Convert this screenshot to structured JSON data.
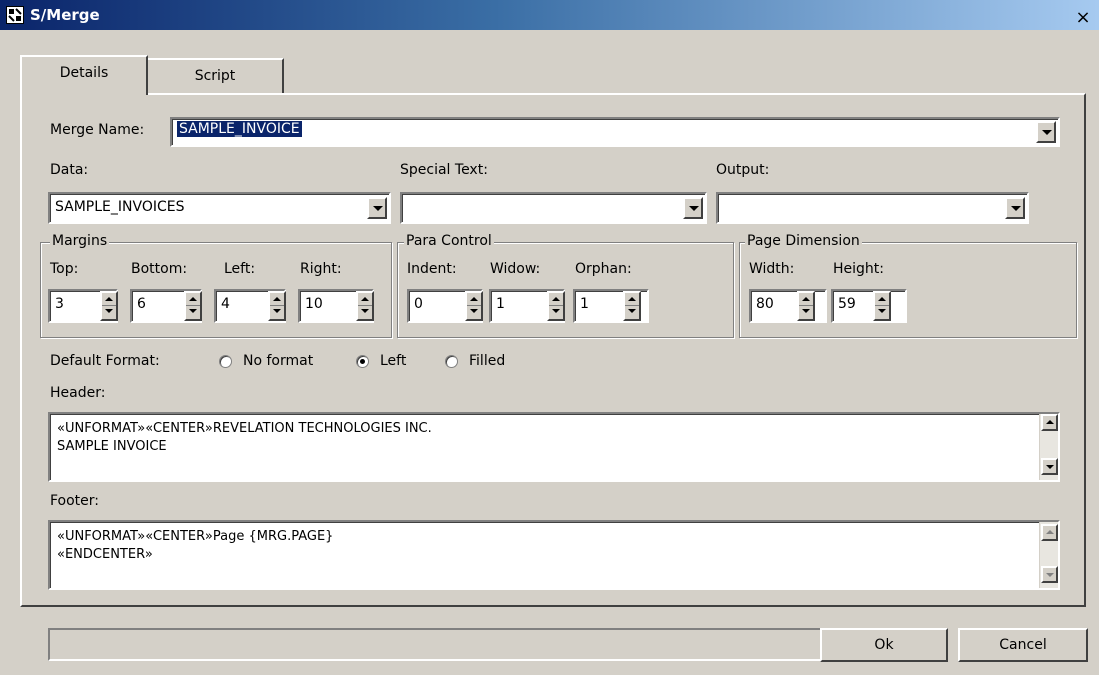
{
  "window": {
    "title": "S/Merge",
    "close_symbol": "×"
  },
  "tabs": [
    {
      "label": "Details",
      "active": true
    },
    {
      "label": "Script",
      "active": false
    }
  ],
  "merge_name": {
    "label": "Merge Name:",
    "value": "SAMPLE_INVOICE"
  },
  "data": {
    "label": "Data:",
    "value": "SAMPLE_INVOICES"
  },
  "special_text": {
    "label": "Special Text:",
    "value": ""
  },
  "output": {
    "label": "Output:",
    "value": ""
  },
  "margins": {
    "title": "Margins",
    "top": {
      "label": "Top:",
      "value": "3"
    },
    "bottom": {
      "label": "Bottom:",
      "value": "6"
    },
    "left": {
      "label": "Left:",
      "value": "4"
    },
    "right": {
      "label": "Right:",
      "value": "10"
    }
  },
  "para_control": {
    "title": "Para Control",
    "indent": {
      "label": "Indent:",
      "value": "0"
    },
    "widow": {
      "label": "Widow:",
      "value": "1"
    },
    "orphan": {
      "label": "Orphan:",
      "value": "1"
    }
  },
  "page_dimension": {
    "title": "Page Dimension",
    "width": {
      "label": "Width:",
      "value": "80"
    },
    "height": {
      "label": "Height:",
      "value": "59"
    }
  },
  "default_format": {
    "label": "Default Format:",
    "options": [
      {
        "label": "No format",
        "checked": false
      },
      {
        "label": "Left",
        "checked": true
      },
      {
        "label": "Filled",
        "checked": false
      }
    ]
  },
  "header": {
    "label": "Header:",
    "text": "«UNFORMAT»«CENTER»REVELATION TECHNOLOGIES INC.\nSAMPLE INVOICE"
  },
  "footer": {
    "label": "Footer:",
    "text": "«UNFORMAT»«CENTER»Page {MRG.PAGE}\n«ENDCENTER»"
  },
  "buttons": {
    "ok": "Ok",
    "cancel": "Cancel"
  },
  "status_text": ""
}
